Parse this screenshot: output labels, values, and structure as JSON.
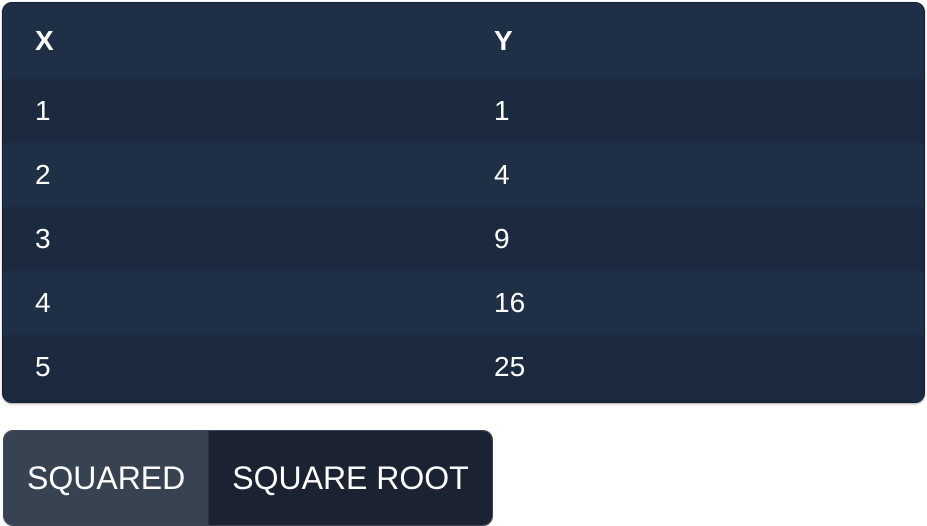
{
  "table": {
    "headers": [
      "X",
      "Y"
    ],
    "rows": [
      [
        "1",
        "1"
      ],
      [
        "2",
        "4"
      ],
      [
        "3",
        "9"
      ],
      [
        "4",
        "16"
      ],
      [
        "5",
        "25"
      ]
    ]
  },
  "mode_buttons": {
    "squared_label": "SQUARED",
    "square_root_label": "SQUARE ROOT",
    "active": "squared"
  },
  "colors": {
    "table_background": "#1b2a3f",
    "table_header": "#1f2f45",
    "button_active": "#384352",
    "button_inactive": "#1b2333",
    "text": "#ffffff"
  }
}
